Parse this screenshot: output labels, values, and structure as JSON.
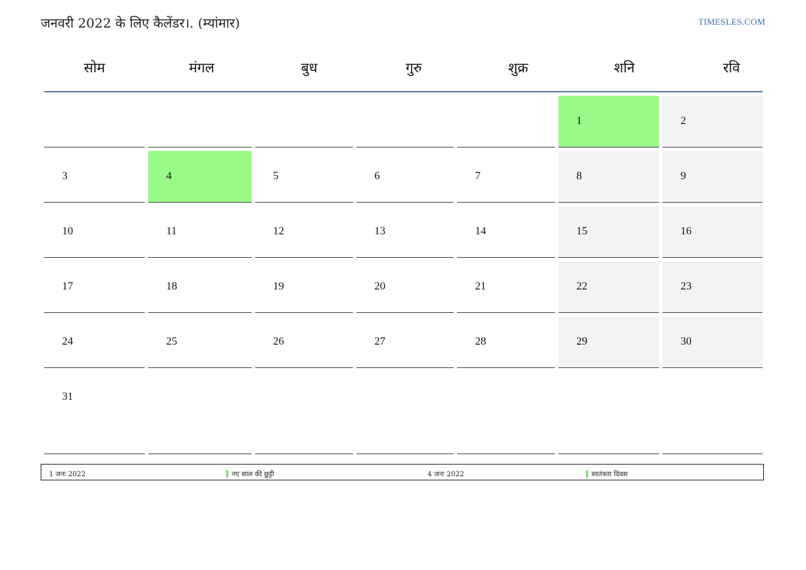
{
  "title": "जनवरी 2022 के लिए कैलेंडर।. (म्यांमार)",
  "site": "TIMESLES.COM",
  "weekdays": [
    "सोम",
    "मंगल",
    "बुध",
    "गुरु",
    "शुक्र",
    "शनि",
    "रवि"
  ],
  "weeks": [
    [
      "",
      "",
      "",
      "",
      "",
      "1",
      "2"
    ],
    [
      "3",
      "4",
      "5",
      "6",
      "7",
      "8",
      "9"
    ],
    [
      "10",
      "11",
      "12",
      "13",
      "14",
      "15",
      "16"
    ],
    [
      "17",
      "18",
      "19",
      "20",
      "21",
      "22",
      "23"
    ],
    [
      "24",
      "25",
      "26",
      "27",
      "28",
      "29",
      "30"
    ],
    [
      "31",
      "",
      "",
      "",
      "",
      "",
      ""
    ]
  ],
  "holidays": [
    {
      "date": "1 जनः 2022",
      "name": "नए साल की छुट्टी"
    },
    {
      "date": "4 जनः 2022",
      "name": "स्वतंत्रता दिवस"
    }
  ],
  "colors": {
    "holiday": "#9afc88",
    "weekend": "#f3f3f3",
    "header_rule": "#5a7aa0",
    "link": "#3b6fb0"
  }
}
